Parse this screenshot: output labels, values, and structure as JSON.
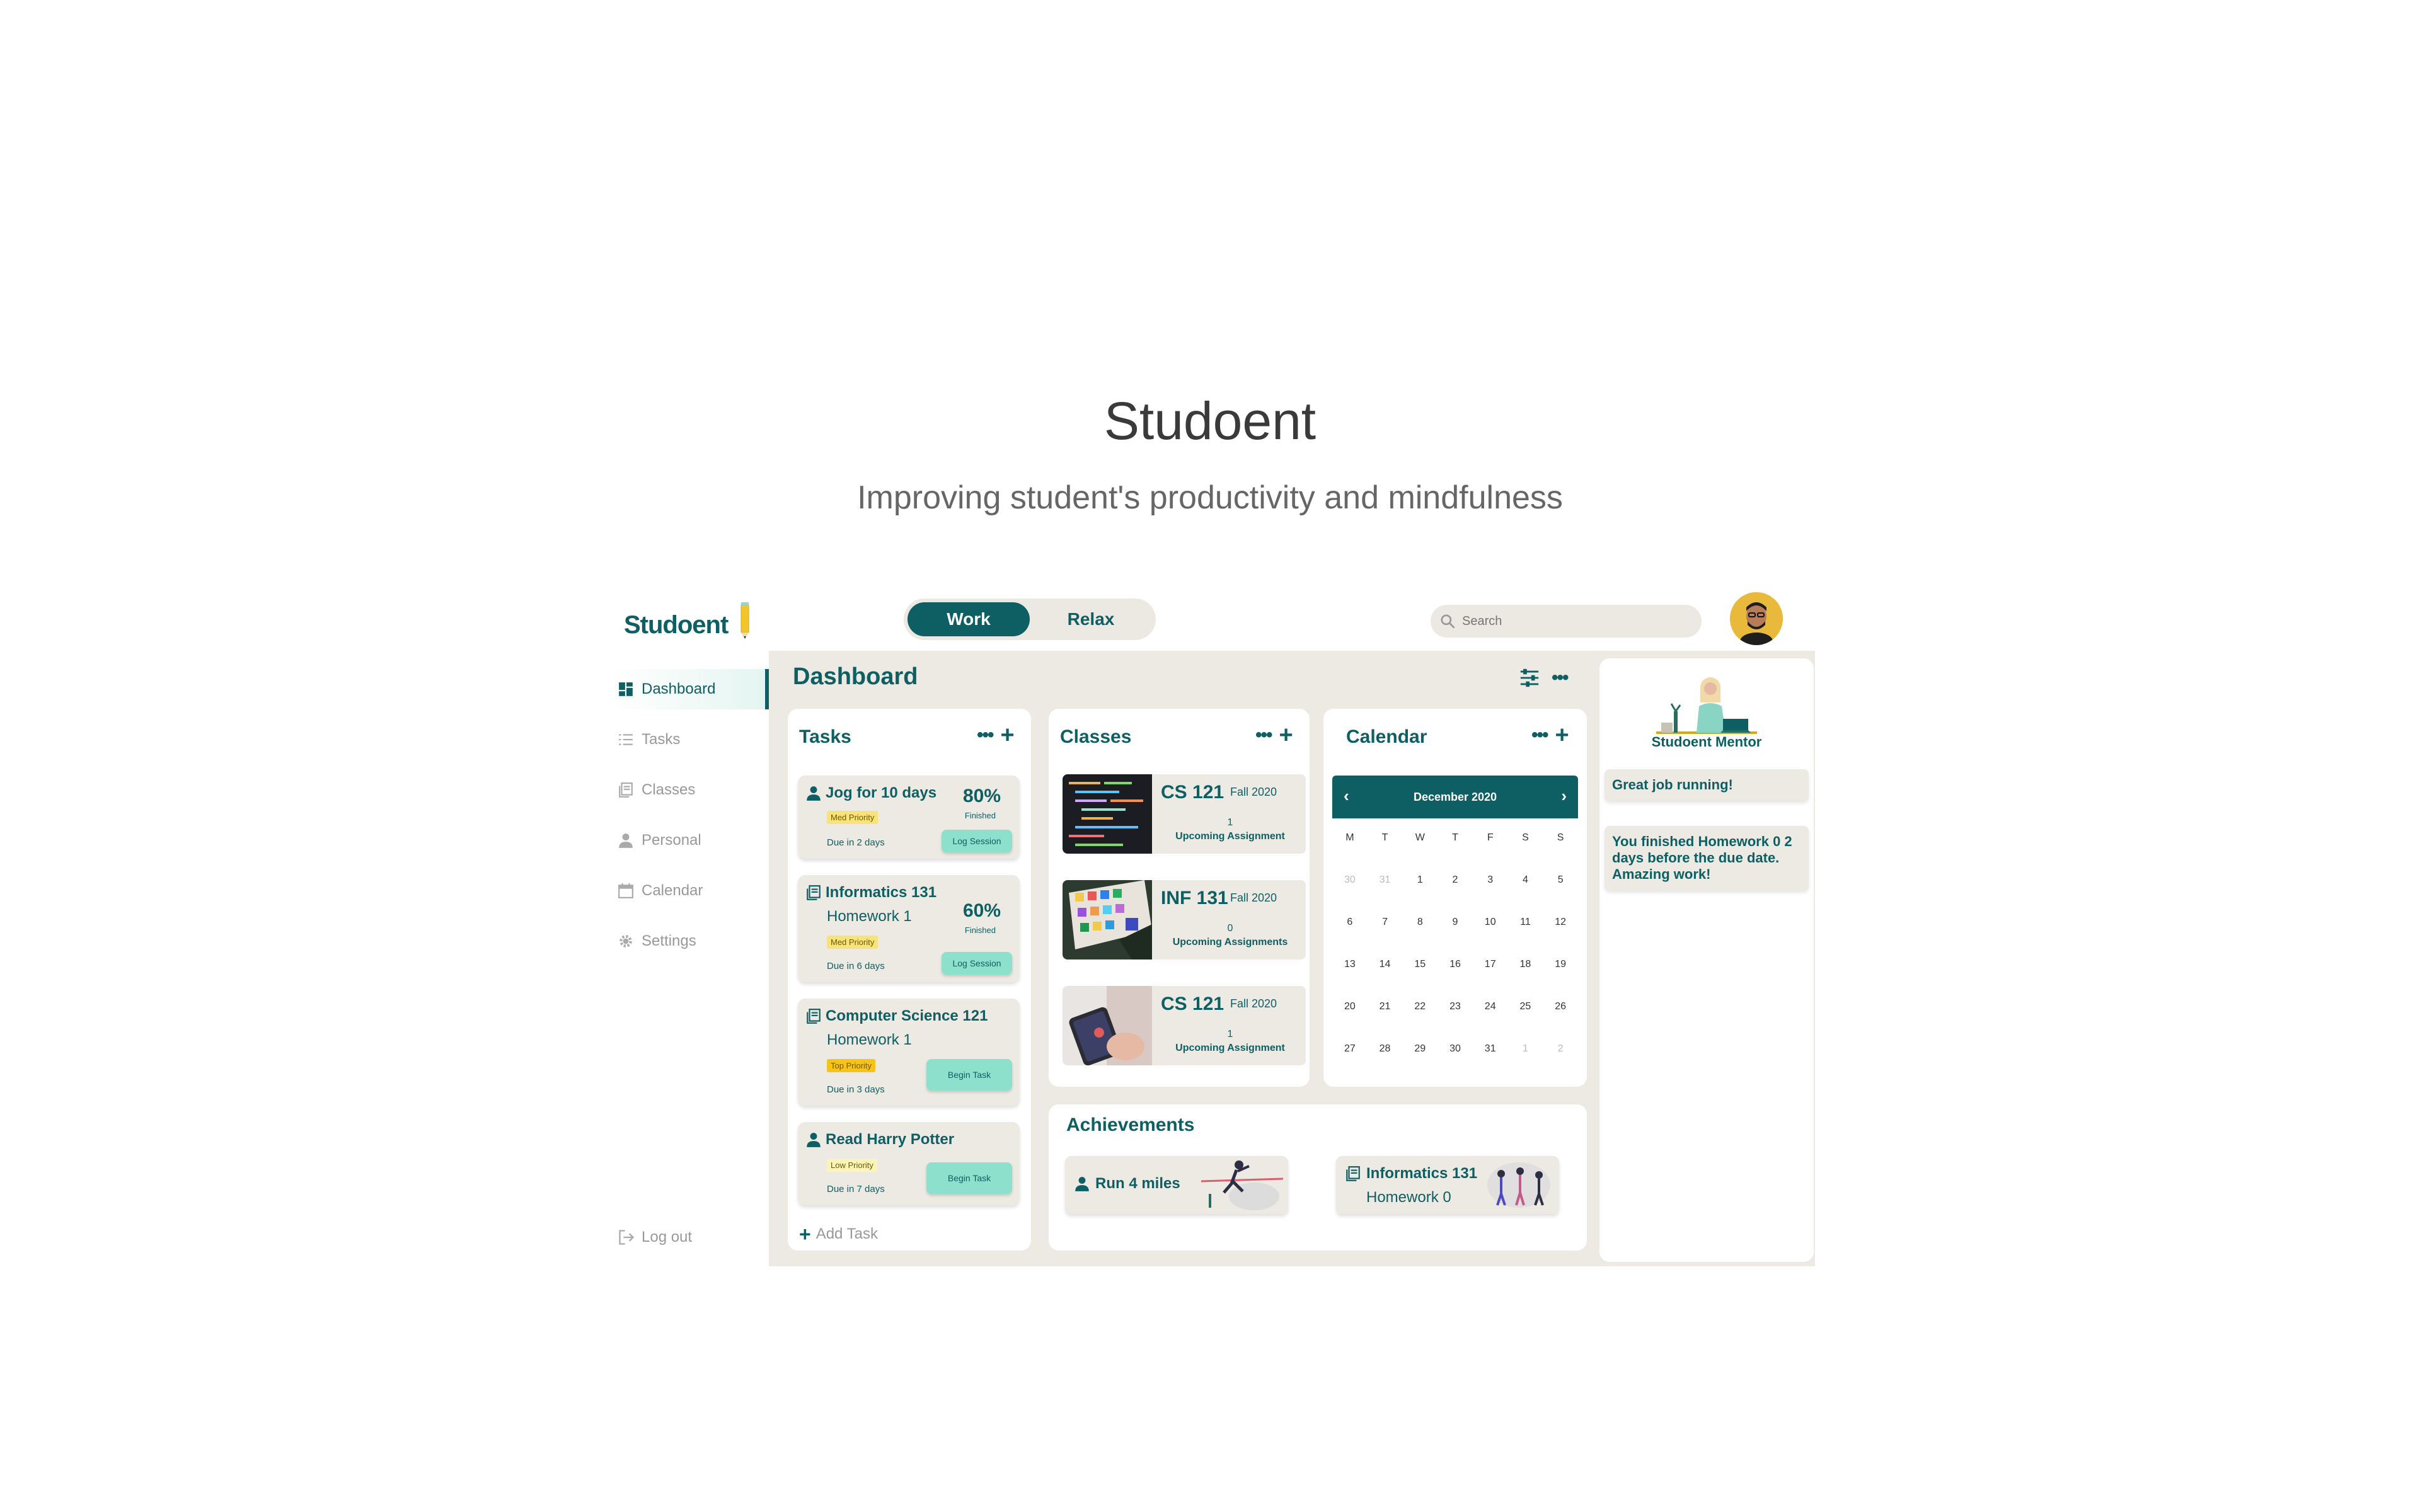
{
  "hero": {
    "title": "Studoent",
    "subtitle": "Improving student's productivity and mindfulness"
  },
  "app": {
    "logo": "Studoent",
    "mode_toggle": {
      "active": "Work",
      "other": "Relax"
    },
    "search": {
      "placeholder": "Search"
    },
    "nav": [
      {
        "label": "Dashboard",
        "icon": "dashboard-icon",
        "active": true
      },
      {
        "label": "Tasks",
        "icon": "list-icon"
      },
      {
        "label": "Classes",
        "icon": "book-icon"
      },
      {
        "label": "Personal",
        "icon": "person-icon"
      },
      {
        "label": "Calendar",
        "icon": "calendar-icon"
      },
      {
        "label": "Settings",
        "icon": "gear-icon"
      }
    ],
    "logout": "Log out",
    "colors": {
      "accent": "#0e5f63",
      "panel": "#ede9e3",
      "button": "#8de0cc"
    }
  },
  "dashboard": {
    "title": "Dashboard",
    "tasks": {
      "title": "Tasks",
      "add_label": "Add Task",
      "items": [
        {
          "title": "Jog for 10 days",
          "subtitle": "",
          "priority": "Med Priority",
          "due": "Due in 2 days",
          "percent": "80%",
          "percent_label": "Finished",
          "button": "Log Session",
          "icon": "person-icon"
        },
        {
          "title": "Informatics 131",
          "subtitle": "Homework 1",
          "priority": "Med Priority",
          "due": "Due in 6 days",
          "percent": "60%",
          "percent_label": "Finished",
          "button": "Log Session",
          "icon": "book-icon"
        },
        {
          "title": "Computer Science 121",
          "subtitle": "Homework 1",
          "priority": "Top Priority",
          "due": "Due in 3 days",
          "button": "Begin Task",
          "icon": "book-icon"
        },
        {
          "title": "Read Harry Potter",
          "priority": "Low Priority",
          "due": "Due in 7 days",
          "button": "Begin Task",
          "icon": "person-icon"
        }
      ]
    },
    "classes": {
      "title": "Classes",
      "items": [
        {
          "code": "CS 121",
          "term": "Fall 2020",
          "count": "1",
          "label": "Upcoming Assignment"
        },
        {
          "code": "INF 131",
          "term": "Fall 2020",
          "count": "0",
          "label": "Upcoming Assignments"
        },
        {
          "code": "CS 121",
          "term": "Fall 2020",
          "count": "1",
          "label": "Upcoming Assignment"
        }
      ]
    },
    "calendar": {
      "title": "Calendar",
      "month": "December 2020",
      "weekdays": [
        "M",
        "T",
        "W",
        "T",
        "F",
        "S",
        "S"
      ],
      "days": [
        "30",
        "31",
        "1",
        "2",
        "3",
        "4",
        "5",
        "6",
        "7",
        "8",
        "9",
        "10",
        "11",
        "12",
        "13",
        "14",
        "15",
        "16",
        "17",
        "18",
        "19",
        "20",
        "21",
        "22",
        "23",
        "24",
        "25",
        "26",
        "27",
        "28",
        "29",
        "30",
        "31",
        "1",
        "2"
      ]
    },
    "achievements": {
      "title": "Achievements",
      "items": [
        {
          "title": "Run 4 miles",
          "subtitle": ""
        },
        {
          "title": "Informatics 131",
          "subtitle": "Homework 0"
        }
      ]
    },
    "mentor": {
      "name": "Studoent Mentor",
      "messages": [
        "Great job running!",
        "You finished Homework 0 2 days before the due date. Amazing work!"
      ]
    }
  }
}
